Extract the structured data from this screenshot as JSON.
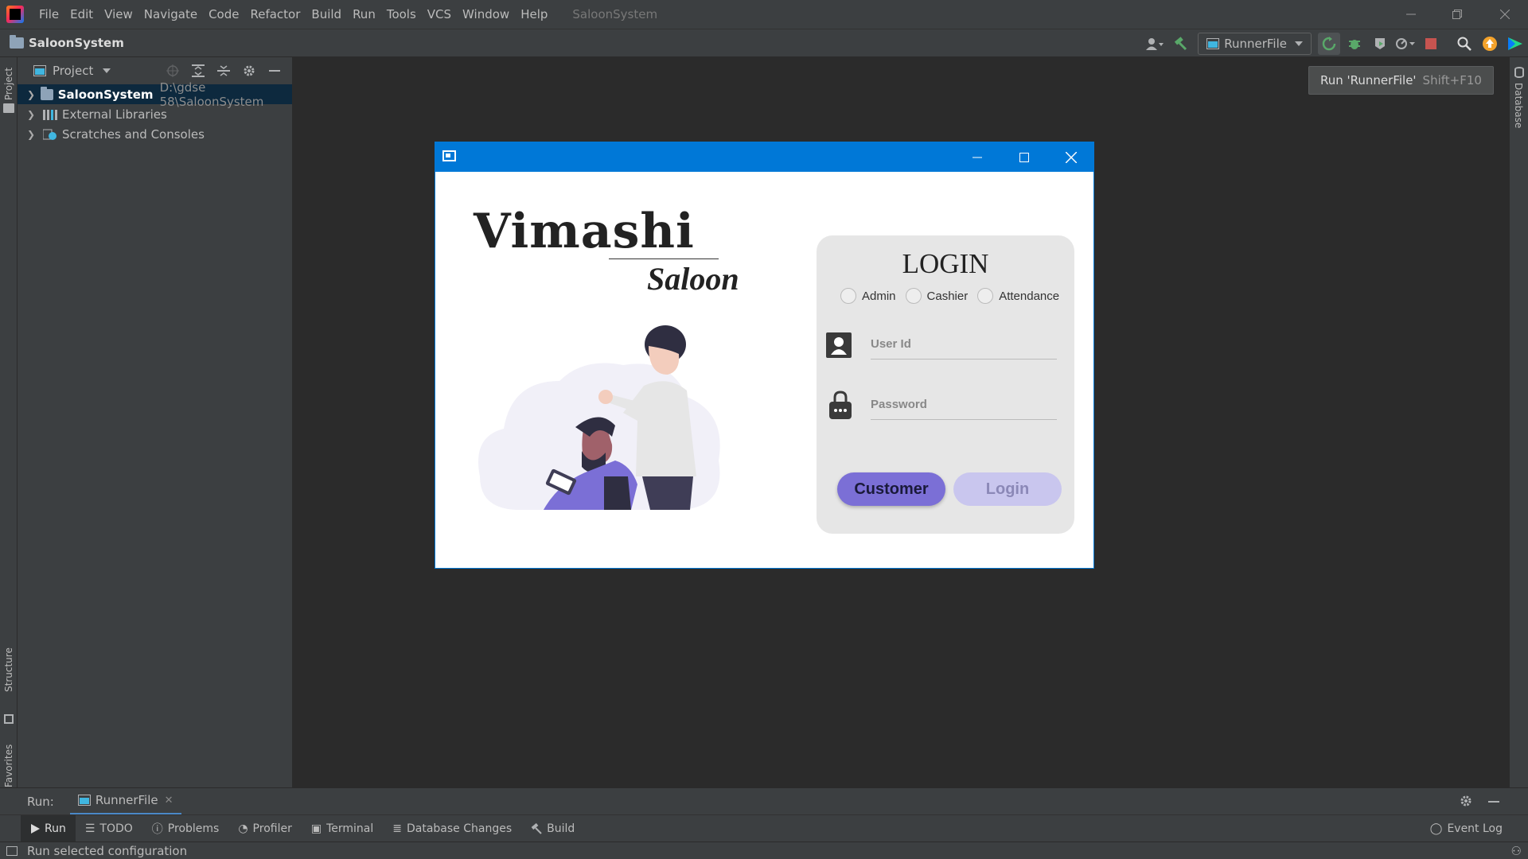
{
  "menubar": {
    "items": [
      "File",
      "Edit",
      "View",
      "Navigate",
      "Code",
      "Refactor",
      "Build",
      "Run",
      "Tools",
      "VCS",
      "Window",
      "Help"
    ],
    "window_title": "SaloonSystem"
  },
  "navbar": {
    "project_name": "SaloonSystem",
    "run_config": "RunnerFile"
  },
  "tooltip": {
    "text": "Run 'RunnerFile'",
    "shortcut": "Shift+F10"
  },
  "left_strip": {
    "project": "Project",
    "structure": "Structure",
    "favorites": "Favorites"
  },
  "right_strip": {
    "database": "Database"
  },
  "project_panel": {
    "header": "Project",
    "tree": [
      {
        "label": "SaloonSystem",
        "path": "D:\\gdse 58\\SaloonSystem"
      },
      {
        "label": "External Libraries"
      },
      {
        "label": "Scratches and Consoles"
      }
    ]
  },
  "app": {
    "brand_title": "Vimashi",
    "brand_subtitle": "Saloon",
    "login": {
      "title": "LOGIN",
      "roles": [
        "Admin",
        "Cashier",
        "Attendance"
      ],
      "userid_placeholder": "User Id",
      "password_placeholder": "Password",
      "customer_button": "Customer",
      "login_button": "Login"
    }
  },
  "run_bar": {
    "label": "Run:",
    "tab": "RunnerFile"
  },
  "bottom_tabs": [
    "Run",
    "TODO",
    "Problems",
    "Profiler",
    "Terminal",
    "Database Changes",
    "Build"
  ],
  "event_log": "Event Log",
  "status_text": "Run selected configuration",
  "colors": {
    "ide_bg": "#2b2b2b",
    "panel_bg": "#3c3f41",
    "window_accent": "#0078d7",
    "customer_button": "#7b6fd6",
    "login_button": "#c9c6ee"
  }
}
